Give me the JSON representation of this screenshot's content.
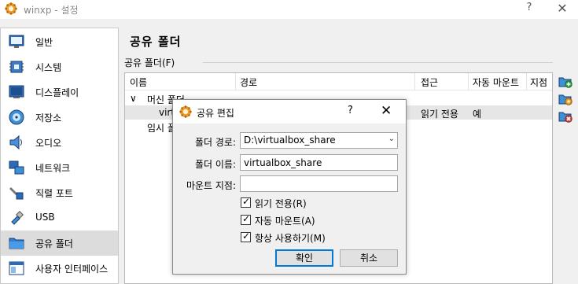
{
  "window": {
    "title": "winxp - 설정",
    "help": "?",
    "close": "✕"
  },
  "sidebar": {
    "items": [
      {
        "label": "일반",
        "icon": "monitor-icon"
      },
      {
        "label": "시스템",
        "icon": "chip-icon"
      },
      {
        "label": "디스플레이",
        "icon": "display-icon"
      },
      {
        "label": "저장소",
        "icon": "disk-icon"
      },
      {
        "label": "오디오",
        "icon": "speaker-icon"
      },
      {
        "label": "네트워크",
        "icon": "network-icon"
      },
      {
        "label": "직렬 포트",
        "icon": "serial-port-icon"
      },
      {
        "label": "USB",
        "icon": "usb-icon"
      },
      {
        "label": "공유 폴더",
        "icon": "folder-icon",
        "selected": true
      },
      {
        "label": "사용자 인터페이스",
        "icon": "ui-icon"
      }
    ]
  },
  "main": {
    "title": "공유 폴더",
    "group_label": "공유 폴더(F)",
    "columns": [
      "이름",
      "경로",
      "접근",
      "자동 마운트",
      "지점"
    ],
    "rows": [
      {
        "expander": "∨",
        "name": "머신 폴더"
      },
      {
        "name": "virt",
        "access": "읽기 전용",
        "automount": "예"
      },
      {
        "name": "임시 폴"
      }
    ]
  },
  "dialog": {
    "title": "공유 편집",
    "help": "?",
    "close": "✕",
    "path_label": "폴더 경로:",
    "path_value": "D:\\virtualbox_share",
    "name_label": "폴더 이름:",
    "name_value": "virtualbox_share",
    "mount_label": "마운트 지점:",
    "mount_value": "",
    "readonly_label": "읽기 전용(R)",
    "automount_label": "자동 마운트(A)",
    "permanent_label": "항상 사용하기(M)",
    "checkmark": "✓",
    "ok_label": "확인",
    "cancel_label": "취소"
  },
  "colors": {
    "accent": "#0078d7",
    "selected_bg": "#dcdcdc"
  }
}
